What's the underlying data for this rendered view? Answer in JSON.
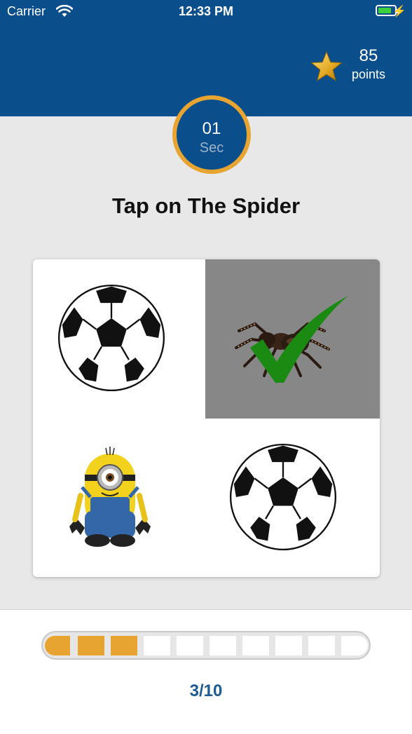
{
  "status_bar": {
    "carrier": "Carrier",
    "time": "12:33 PM",
    "wifi_icon": "wifi-icon",
    "battery_icon": "battery-icon"
  },
  "header": {
    "points_value": "85",
    "points_label": "points",
    "star_icon": "star-icon"
  },
  "timer": {
    "value": "01",
    "unit": "Sec"
  },
  "question": "Tap on The Spider",
  "options": [
    {
      "id": "soccer-ball-1",
      "selected": false
    },
    {
      "id": "spider",
      "selected": true,
      "correct": true
    },
    {
      "id": "minion",
      "selected": false
    },
    {
      "id": "soccer-ball-2",
      "selected": false
    }
  ],
  "progress": {
    "label": "3/10",
    "current": 3,
    "total": 10
  },
  "colors": {
    "primary": "#0a4e8c",
    "accent": "#e8a431",
    "background": "#e8e8e8",
    "check": "#1a8a12",
    "progress_text": "#1d5b95"
  }
}
